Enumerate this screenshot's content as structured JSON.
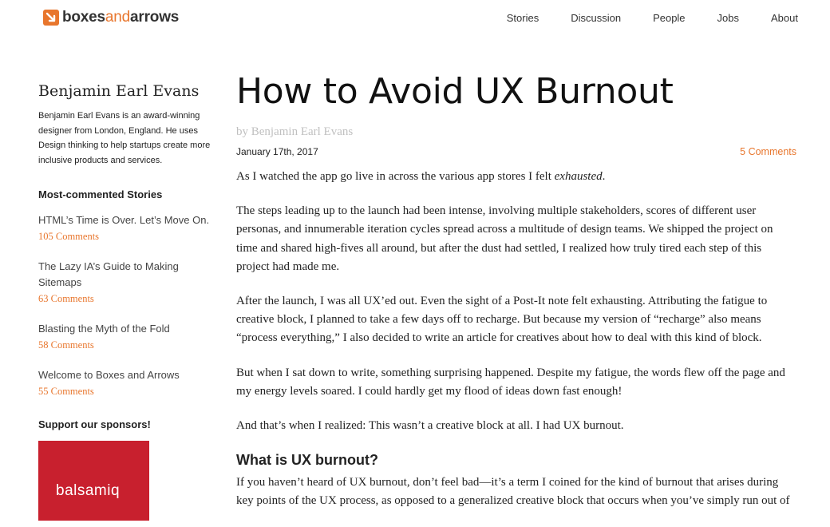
{
  "header": {
    "logo": {
      "part1": "boxes",
      "part2": "and",
      "part3": "arrows",
      "accent": "#e8762d"
    },
    "nav": [
      "Stories",
      "Discussion",
      "People",
      "Jobs",
      "About"
    ]
  },
  "sidebar": {
    "author_name": "Benjamin Earl Evans",
    "author_bio": "Benjamin Earl Evans is an award-winning designer from London, England. He uses Design thinking to help startups create more inclusive products and services.",
    "most_commented_heading": "Most-commented Stories",
    "stories": [
      {
        "title": "HTML’s Time is Over. Let’s Move On.",
        "comments": "105 Comments"
      },
      {
        "title": "The Lazy IA’s Guide to Making Sitemaps",
        "comments": "63 Comments"
      },
      {
        "title": "Blasting the Myth of the Fold",
        "comments": "58 Comments"
      },
      {
        "title": "Welcome to Boxes and Arrows",
        "comments": "55 Comments"
      }
    ],
    "sponsors_heading": "Support our sponsors!",
    "sponsor": {
      "text": "balsamiq",
      "color": "#c8202e"
    }
  },
  "article": {
    "title": "How to Avoid UX Burnout",
    "byline": "by Benjamin Earl Evans",
    "date": "January 17th, 2017",
    "comments": "5 Comments",
    "p1_before": "As I watched the app go live in across the various app stores I felt ",
    "p1_em": "exhausted",
    "p1_after": ".",
    "p2": "The steps leading up to the launch had been intense, involving multiple stakeholders, scores of different user personas, and innumerable iteration cycles spread across a multitude of design teams. We shipped the project on time and shared high-fives all around, but after the dust had settled, I realized how truly tired each step of this project had made me.",
    "p3": "After the launch, I was all UX’ed out. Even the sight of a Post-It note felt exhausting. Attributing the fatigue to creative block, I planned to take a few days off to recharge. But because my version of “recharge” also means “process everything,” I also decided to write an article for creatives about how to deal with this kind of block.",
    "p4": "But when I sat down to write, something surprising happened. Despite my fatigue, the words flew off the page and my energy levels soared. I could hardly get my flood of ideas down fast enough!",
    "p5": "And that’s when I realized: This wasn’t a creative block at all. I had UX burnout.",
    "section_heading": "What is UX burnout?",
    "p6": "If you haven’t heard of UX burnout, don’t feel bad—it’s a term I coined for the kind of burnout that arises during key points of the UX process, as opposed to a generalized creative block that occurs when you’ve simply run out of"
  }
}
